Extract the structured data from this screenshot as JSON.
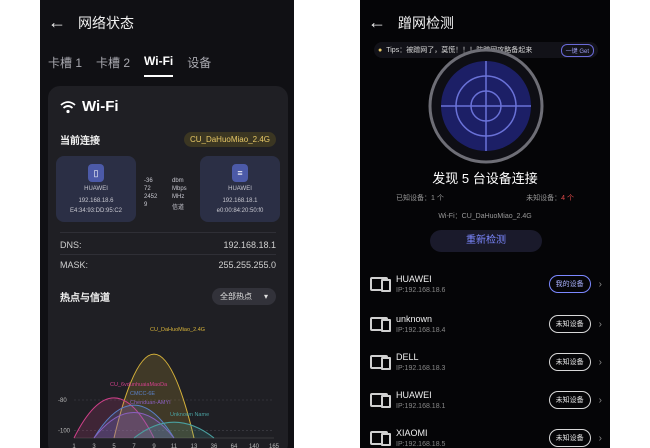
{
  "left": {
    "header": {
      "title": "网络状态"
    },
    "tabs": [
      {
        "label": "卡槽 1"
      },
      {
        "label": "卡槽 2"
      },
      {
        "label": "Wi-Fi"
      },
      {
        "label": "设备"
      }
    ],
    "card": {
      "title": "Wi-Fi",
      "current_label": "当前连接",
      "ssid": "CU_DaHuoMiao_2.4G",
      "device_left": {
        "name": "HUAWEI",
        "ip": "192.168.18.6",
        "mac": "E4:34:93:DD:95:C2"
      },
      "device_right": {
        "name": "HUAWEI",
        "ip": "192.168.18.1",
        "mac": "e0:00:84:20:50:f0"
      },
      "stats": [
        {
          "value": "-36",
          "unit": "dbm"
        },
        {
          "value": "72",
          "unit": "Mbps"
        },
        {
          "value": "2452",
          "unit": "MHz"
        },
        {
          "value": "9",
          "unit": "信道"
        }
      ],
      "dns_label": "DNS:",
      "dns_value": "192.168.18.1",
      "mask_label": "MASK:",
      "mask_value": "255.255.255.0",
      "hotspot_label": "热点与信道",
      "hotspot_select": "全部热点",
      "chart_labels": {
        "ssid_main": "CU_DaHuoMiao_2.4G",
        "ssid_other": "Unknown Name",
        "ssid_a": "CU_6vdunhuaiaMaoDa",
        "ssid_b": "CMCC-6E",
        "ssid_c": "Chenduan-AMYI"
      }
    }
  },
  "right": {
    "header": {
      "title": "蹭网检测"
    },
    "tips": {
      "text": "Tips：被蹭网了，莫慌！！！防蹭网攻略备起来",
      "get_label": "一键 Get"
    },
    "found_text": "发现 5 台设备连接",
    "known_label": "已知设备：",
    "known_count": "1 个",
    "unknown_label": "未知设备：",
    "unknown_count": "4 个",
    "wifi_line": "Wi-Fi：CU_DaHuoMiao_2.4G",
    "redetect_label": "重新检测",
    "devices": [
      {
        "name": "HUAWEI",
        "ip": "IP:192.168.18.6",
        "tag": "我的设备"
      },
      {
        "name": "unknown",
        "ip": "IP:192.168.18.4",
        "tag": "未知设备"
      },
      {
        "name": "DELL",
        "ip": "IP:192.168.18.3",
        "tag": "未知设备"
      },
      {
        "name": "HUAWEI",
        "ip": "IP:192.168.18.1",
        "tag": "未知设备"
      },
      {
        "name": "XIAOMI",
        "ip": "IP:192.168.18.5",
        "tag": "未知设备"
      }
    ]
  },
  "chart_data": {
    "type": "area",
    "x_ticks": [
      "1",
      "3",
      "5",
      "7",
      "9",
      "11",
      "13",
      "36",
      "64",
      "140",
      "165"
    ],
    "y_ticks": [
      "-100",
      "-80"
    ],
    "series": [
      {
        "name": "CU_DaHuoMiao_2.4G",
        "center_tick": 4,
        "level": -36
      },
      {
        "name": "CU_6vdunhuaiaMaoDa",
        "center_tick": 2,
        "level": -72
      },
      {
        "name": "CMCC-6E",
        "center_tick": 3,
        "level": -78
      },
      {
        "name": "Chenduan-AMYI",
        "center_tick": 3,
        "level": -84
      },
      {
        "name": "Unknown Name",
        "center_tick": 5,
        "level": -92
      }
    ],
    "colors": [
      "#d6b23a",
      "#d0408a",
      "#5a80c8",
      "#8a5fc0",
      "#4aa0a0"
    ]
  }
}
